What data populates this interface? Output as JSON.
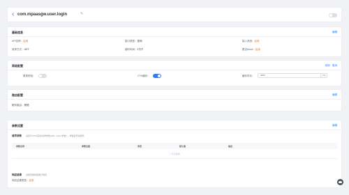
{
  "header": {
    "back_glyph": "‹",
    "title": "com.mpaasgw.user.login",
    "edit_glyph": "✎"
  },
  "basic_info": {
    "title": "基础信息",
    "edit_label": "编辑",
    "api_name_label": "API名称：",
    "api_name_value": "启用",
    "interface_type_label": "接口类型：",
    "interface_type_value": "查询",
    "access_system_label": "接入系统：",
    "access_system_value": "启用",
    "request_method_label": "请求方式：",
    "request_method_value": "GET",
    "timeout_label": "超时时间：",
    "timeout_value": "2万千",
    "mock_label": "是否Mock：",
    "mock_value": "启用"
  },
  "advanced": {
    "title": "高级配置",
    "save_label": "保存",
    "cancel_label": "取消",
    "login_check_label": "登录校验：",
    "cache_label": "CTN缓存：",
    "timeout_label": "缓存时长：",
    "timeout_value": "3000",
    "timeout_unit": "ms"
  },
  "proxy": {
    "title": "路由配置",
    "edit_label": "编辑",
    "service_label": "服务路由：",
    "service_value": "其他"
  },
  "params": {
    "title": "参数设置",
    "edit_label": "编辑",
    "request_title": "请求参数",
    "request_hint": "设置与API对应的请求参数(URL, Query参数) ，参数名称请依照",
    "columns": [
      "参数名称",
      "参数位置",
      "类型",
      "默认值",
      "描述"
    ],
    "empty_text": "☐ 暂无数据",
    "response_title": "响应结果",
    "response_hint": "请按定制的结果示例值",
    "response_type_label": "响应结果类型：",
    "response_type_value": "启用"
  },
  "colors": {
    "accent": "#2f7bff",
    "warning": "#ff6a00"
  }
}
